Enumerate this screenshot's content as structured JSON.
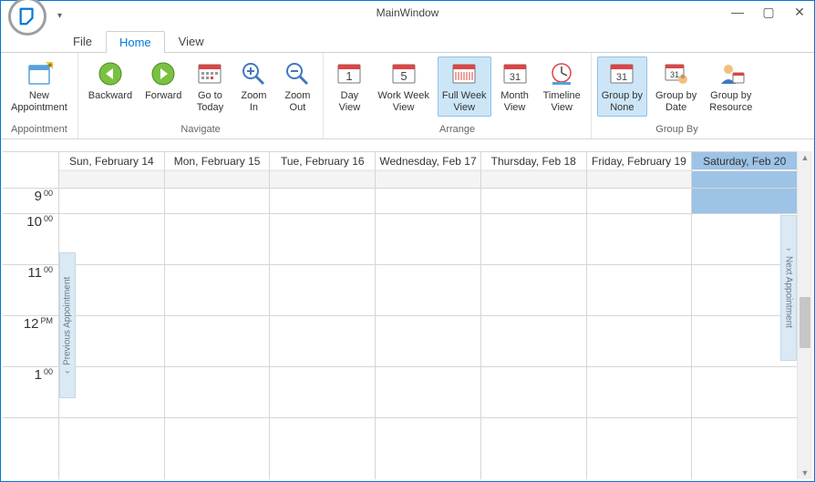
{
  "window": {
    "title": "MainWindow"
  },
  "tabs": {
    "file": "File",
    "home": "Home",
    "view": "View",
    "active": "Home"
  },
  "ribbon": {
    "appointment": {
      "newAppt": "New\nAppointment",
      "groupLabel": "Appointment"
    },
    "navigate": {
      "backward": "Backward",
      "forward": "Forward",
      "gotoToday": "Go to\nToday",
      "zoomIn": "Zoom\nIn",
      "zoomOut": "Zoom\nOut",
      "groupLabel": "Navigate"
    },
    "arrange": {
      "dayView": "Day\nView",
      "workWeek": "Work Week\nView",
      "fullWeek": "Full Week\nView",
      "monthView": "Month\nView",
      "timeline": "Timeline\nView",
      "groupLabel": "Arrange"
    },
    "groupBy": {
      "none": "Group by\nNone",
      "date": "Group by\nDate",
      "resource": "Group by\nResource",
      "groupLabel": "Group By"
    }
  },
  "calendar": {
    "days": [
      {
        "label": "Sun, February 14",
        "today": false
      },
      {
        "label": "Mon, February 15",
        "today": false
      },
      {
        "label": "Tue, February 16",
        "today": false
      },
      {
        "label": "Wednesday, Feb 17",
        "today": false
      },
      {
        "label": "Thursday, Feb 18",
        "today": false
      },
      {
        "label": "Friday, February 19",
        "today": false
      },
      {
        "label": "Saturday, Feb 20",
        "today": true
      }
    ],
    "times": [
      {
        "hour": "9",
        "suffix": "00"
      },
      {
        "hour": "10",
        "suffix": "00"
      },
      {
        "hour": "11",
        "suffix": "00"
      },
      {
        "hour": "12",
        "suffix": "PM"
      },
      {
        "hour": "1",
        "suffix": "00"
      }
    ],
    "prevAppt": "Previous Appointment",
    "nextAppt": "Next Appointment"
  }
}
